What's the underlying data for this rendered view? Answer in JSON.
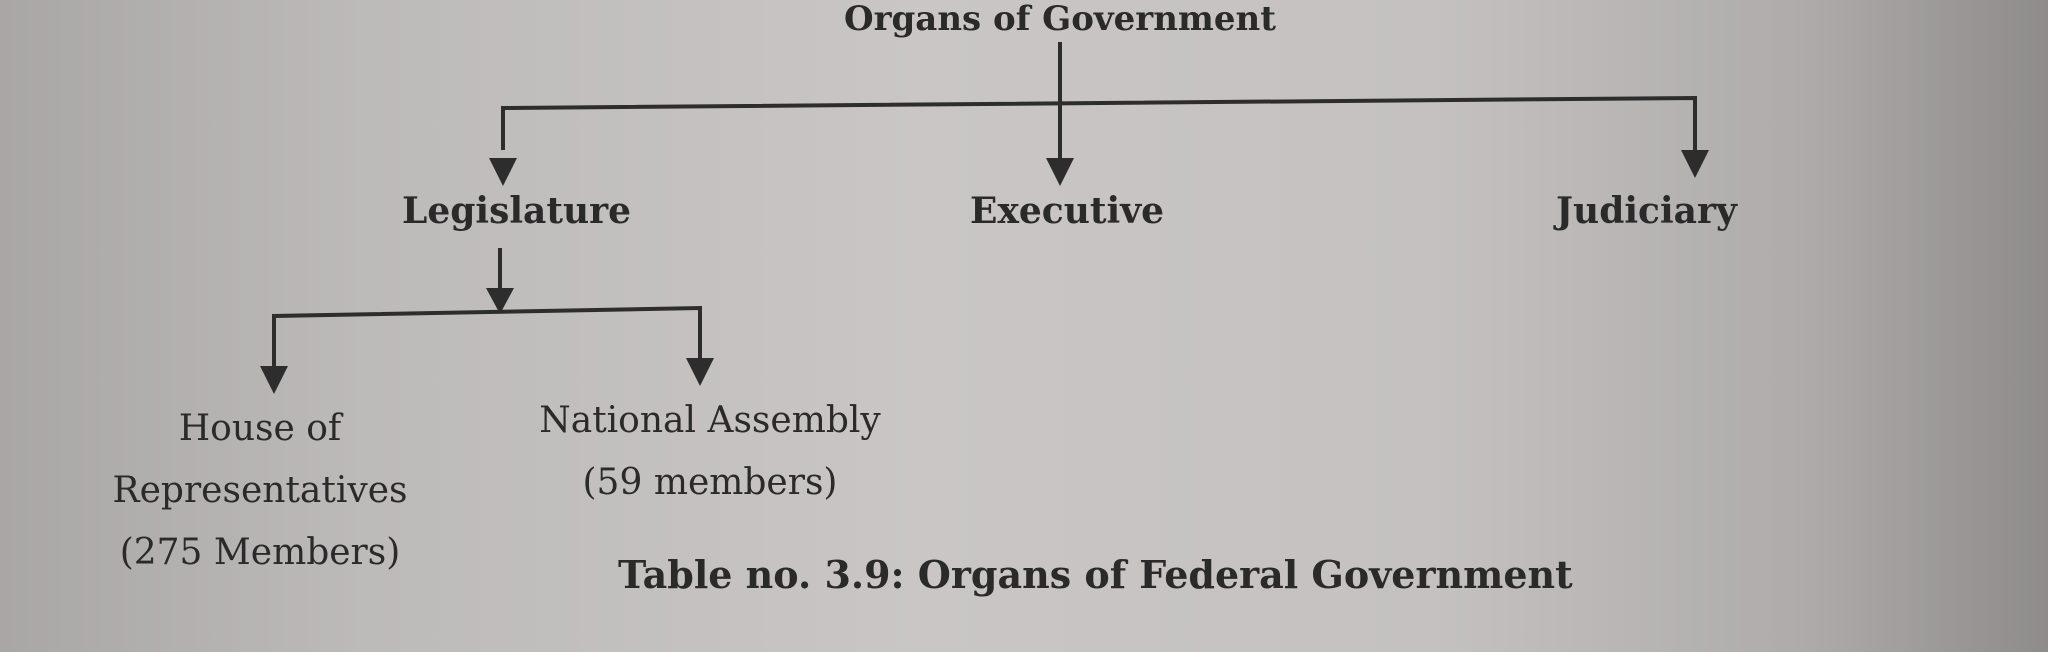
{
  "diagram": {
    "root": "Organs of Government",
    "branches": [
      {
        "label": "Legislature"
      },
      {
        "label": "Executive"
      },
      {
        "label": "Judiciary"
      }
    ],
    "legislature_children": [
      {
        "lines": [
          "House of",
          "Representatives",
          "(275 Members)"
        ]
      },
      {
        "lines": [
          "National Assembly",
          "(59 members)"
        ]
      }
    ],
    "caption": "Table no. 3.9: Organs of Federal Government"
  },
  "colors": {
    "ink": "#2b2a2a",
    "paper": "#c4c1c0"
  }
}
